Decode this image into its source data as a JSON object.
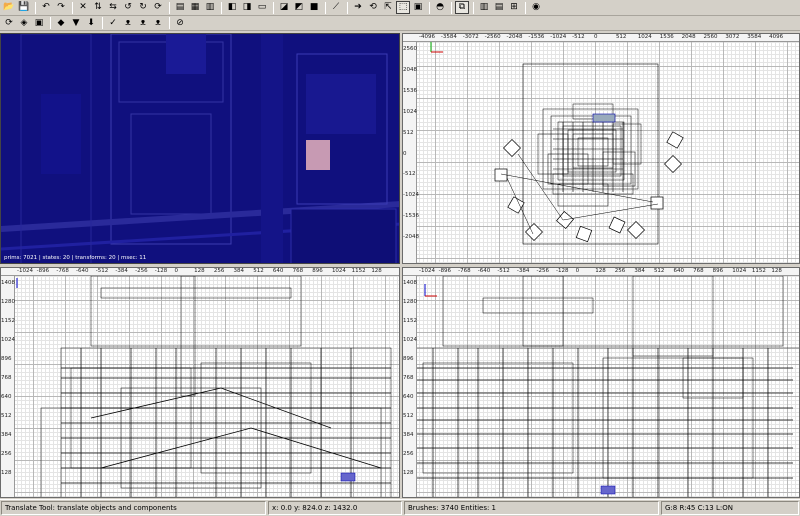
{
  "toolbar1": {
    "groups": [
      [
        {
          "name": "open-icon",
          "glyph": "📂"
        },
        {
          "name": "save-icon",
          "glyph": "💾"
        }
      ],
      [
        {
          "name": "undo-icon",
          "glyph": "↶"
        },
        {
          "name": "redo-icon",
          "glyph": "↷"
        }
      ],
      [
        {
          "name": "flip-x-icon",
          "glyph": "✕"
        },
        {
          "name": "flip-y-icon",
          "glyph": "⇅"
        },
        {
          "name": "flip-z-icon",
          "glyph": "⇆"
        },
        {
          "name": "rotate-x-icon",
          "glyph": "↺"
        },
        {
          "name": "rotate-y-icon",
          "glyph": "↻"
        },
        {
          "name": "rotate-z-icon",
          "glyph": "⟳"
        }
      ],
      [
        {
          "name": "select-complete-tall-icon",
          "glyph": "▤"
        },
        {
          "name": "select-touching-icon",
          "glyph": "▦"
        },
        {
          "name": "select-inside-icon",
          "glyph": "▥"
        }
      ],
      [
        {
          "name": "view-xy-icon",
          "glyph": "◧"
        },
        {
          "name": "view-change-icon",
          "glyph": "◨"
        },
        {
          "name": "view-xz-icon",
          "glyph": "▭"
        }
      ],
      [
        {
          "name": "csg-subtract-icon",
          "glyph": "◪"
        },
        {
          "name": "csg-merge-icon",
          "glyph": "◩"
        },
        {
          "name": "csg-hollow-icon",
          "glyph": "■"
        }
      ],
      [
        {
          "name": "clipper-icon",
          "glyph": "⟋"
        }
      ],
      [
        {
          "name": "translate-tool-icon",
          "glyph": "➔"
        },
        {
          "name": "rotate-tool-icon",
          "glyph": "⟲"
        },
        {
          "name": "scale-tool-icon",
          "glyph": "⇱"
        },
        {
          "name": "drag-tool-icon",
          "glyph": "⬚",
          "on": true
        },
        {
          "name": "resize-tool-icon",
          "glyph": "▣"
        }
      ],
      [
        {
          "name": "camera-preview-icon",
          "glyph": "◓"
        }
      ],
      [
        {
          "name": "texture-lock-icon",
          "glyph": "⧉",
          "on": true
        }
      ],
      [
        {
          "name": "layout-split-icon",
          "glyph": "▥"
        },
        {
          "name": "layout-float-icon",
          "glyph": "▤"
        },
        {
          "name": "layout-regular-icon",
          "glyph": "⊞"
        }
      ],
      [
        {
          "name": "patch-icon",
          "glyph": "◉"
        }
      ]
    ]
  },
  "toolbar2": {
    "groups": [
      [
        {
          "name": "refresh-icon",
          "glyph": "⟳"
        },
        {
          "name": "filter-brush-icon",
          "glyph": "◈"
        },
        {
          "name": "filter-entity-icon",
          "glyph": "▣"
        }
      ],
      [
        {
          "name": "shader-icon",
          "glyph": "◆"
        },
        {
          "name": "hide-icon",
          "glyph": "▼"
        },
        {
          "name": "show-icon",
          "glyph": "⬇"
        }
      ],
      [
        {
          "name": "select-all-icon",
          "glyph": "✓"
        },
        {
          "name": "cat-icon-1",
          "glyph": "ᴥ"
        },
        {
          "name": "cat-icon-2",
          "glyph": "ᴥ"
        },
        {
          "name": "cat-icon-3",
          "glyph": "ᴥ"
        }
      ],
      [
        {
          "name": "clear-selection-icon",
          "glyph": "⊘"
        }
      ]
    ]
  },
  "viewports": {
    "camera": {
      "stats": "prims: 7021 | states: 20 | transforms: 20 | msec: 11"
    },
    "top": {
      "ruler_top": [
        "-4096",
        "-3584",
        "-3072",
        "-2560",
        "-2048",
        "-1536",
        "-1024",
        "-512",
        "0",
        "512",
        "1024",
        "1536",
        "2048",
        "2560",
        "3072",
        "3584",
        "4096"
      ],
      "ruler_left": [
        "2560",
        "2048",
        "1536",
        "1024",
        "512",
        "0",
        "-512",
        "-1024",
        "-1536",
        "-2048"
      ]
    },
    "side": {
      "ruler_top": [
        "-1024",
        "-896",
        "-768",
        "-640",
        "-512",
        "-384",
        "-256",
        "-128",
        "0",
        "128",
        "256",
        "384",
        "512",
        "640",
        "768",
        "896",
        "1024",
        "1152",
        "128"
      ],
      "ruler_left": [
        "1408",
        "1280",
        "1152",
        "1024",
        "896",
        "768",
        "640",
        "512",
        "384",
        "256",
        "128"
      ]
    },
    "front": {
      "ruler_top": [
        "-1024",
        "-896",
        "-768",
        "-640",
        "-512",
        "-384",
        "-256",
        "-128",
        "0",
        "128",
        "256",
        "384",
        "512",
        "640",
        "768",
        "896",
        "1024",
        "1152",
        "128"
      ],
      "ruler_left": [
        "1408",
        "1280",
        "1152",
        "1024",
        "896",
        "768",
        "640",
        "512",
        "384",
        "256",
        "128"
      ]
    }
  },
  "statusbar": {
    "message": "Translate Tool: translate objects and components",
    "coords": "x:    0.0  y:   824.0  z:  1432.0",
    "counts": "Brushes: 3740 Entities: 1",
    "grid": "G:8  R:45  C:13  L:ON"
  }
}
